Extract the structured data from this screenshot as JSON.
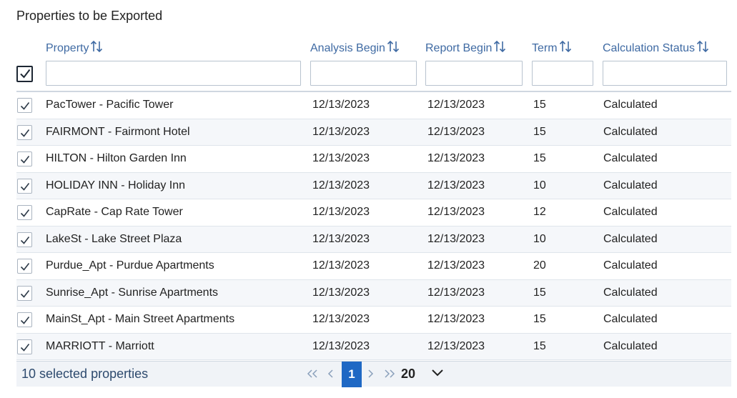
{
  "title": "Properties to be Exported",
  "columns": {
    "property": "Property",
    "analysis_begin": "Analysis Begin",
    "report_begin": "Report Begin",
    "term": "Term",
    "calculation_status": "Calculation Status"
  },
  "rows": [
    {
      "property": "PacTower - Pacific Tower",
      "analysis_begin": "12/13/2023",
      "report_begin": "12/13/2023",
      "term": "15",
      "status": "Calculated"
    },
    {
      "property": "FAIRMONT - Fairmont Hotel",
      "analysis_begin": "12/13/2023",
      "report_begin": "12/13/2023",
      "term": "15",
      "status": "Calculated"
    },
    {
      "property": "HILTON - Hilton Garden Inn",
      "analysis_begin": "12/13/2023",
      "report_begin": "12/13/2023",
      "term": "15",
      "status": "Calculated"
    },
    {
      "property": "HOLIDAY INN - Holiday Inn",
      "analysis_begin": "12/13/2023",
      "report_begin": "12/13/2023",
      "term": "10",
      "status": "Calculated"
    },
    {
      "property": "CapRate - Cap Rate Tower",
      "analysis_begin": "12/13/2023",
      "report_begin": "12/13/2023",
      "term": "12",
      "status": "Calculated"
    },
    {
      "property": "LakeSt - Lake Street Plaza",
      "analysis_begin": "12/13/2023",
      "report_begin": "12/13/2023",
      "term": "10",
      "status": "Calculated"
    },
    {
      "property": "Purdue_Apt - Purdue Apartments",
      "analysis_begin": "12/13/2023",
      "report_begin": "12/13/2023",
      "term": "20",
      "status": "Calculated"
    },
    {
      "property": "Sunrise_Apt - Sunrise Apartments",
      "analysis_begin": "12/13/2023",
      "report_begin": "12/13/2023",
      "term": "15",
      "status": "Calculated"
    },
    {
      "property": "MainSt_Apt - Main Street Apartments",
      "analysis_begin": "12/13/2023",
      "report_begin": "12/13/2023",
      "term": "15",
      "status": "Calculated"
    },
    {
      "property": "MARRIOTT - Marriott",
      "analysis_begin": "12/13/2023",
      "report_begin": "12/13/2023",
      "term": "15",
      "status": "Calculated"
    }
  ],
  "footer": {
    "selected_text": "10 selected properties",
    "current_page": "1",
    "page_size": "20"
  },
  "colors": {
    "header_text": "#3f6aa3",
    "current_page_bg": "#1f68c4",
    "row_alt_bg": "#f5f7fa",
    "footer_bg": "#f0f3f7"
  },
  "icons": {
    "sort": "sort-icon",
    "check": "check-icon",
    "first_page": "first-page-icon",
    "prev_page": "prev-page-icon",
    "next_page": "next-page-icon",
    "last_page": "last-page-icon",
    "page_size_dropdown": "chevron-down-icon"
  }
}
